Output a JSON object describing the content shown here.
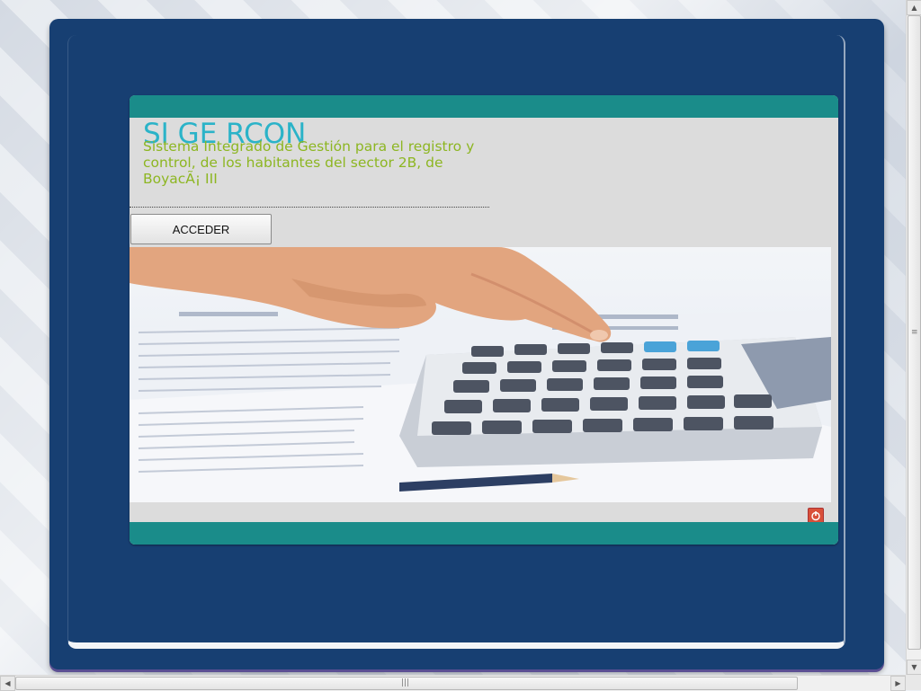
{
  "header": {
    "brand": "SI GE RCON",
    "subtitle": "Sistema Integrado de Gestión para el registro y control, de los habitantes del sector 2B, de BoyacÃ¡ III"
  },
  "actions": {
    "acceder_label": "ACCEDER"
  },
  "colors": {
    "page_frame": "#173f72",
    "panel_bars": "#1a8c8a",
    "brand_text": "#2bb3c8",
    "subtitle_text": "#8db622",
    "power_button": "#d9503a"
  },
  "icons": {
    "power": "power-icon"
  },
  "hero_image": "calculator-with-hand-and-spreadsheets"
}
